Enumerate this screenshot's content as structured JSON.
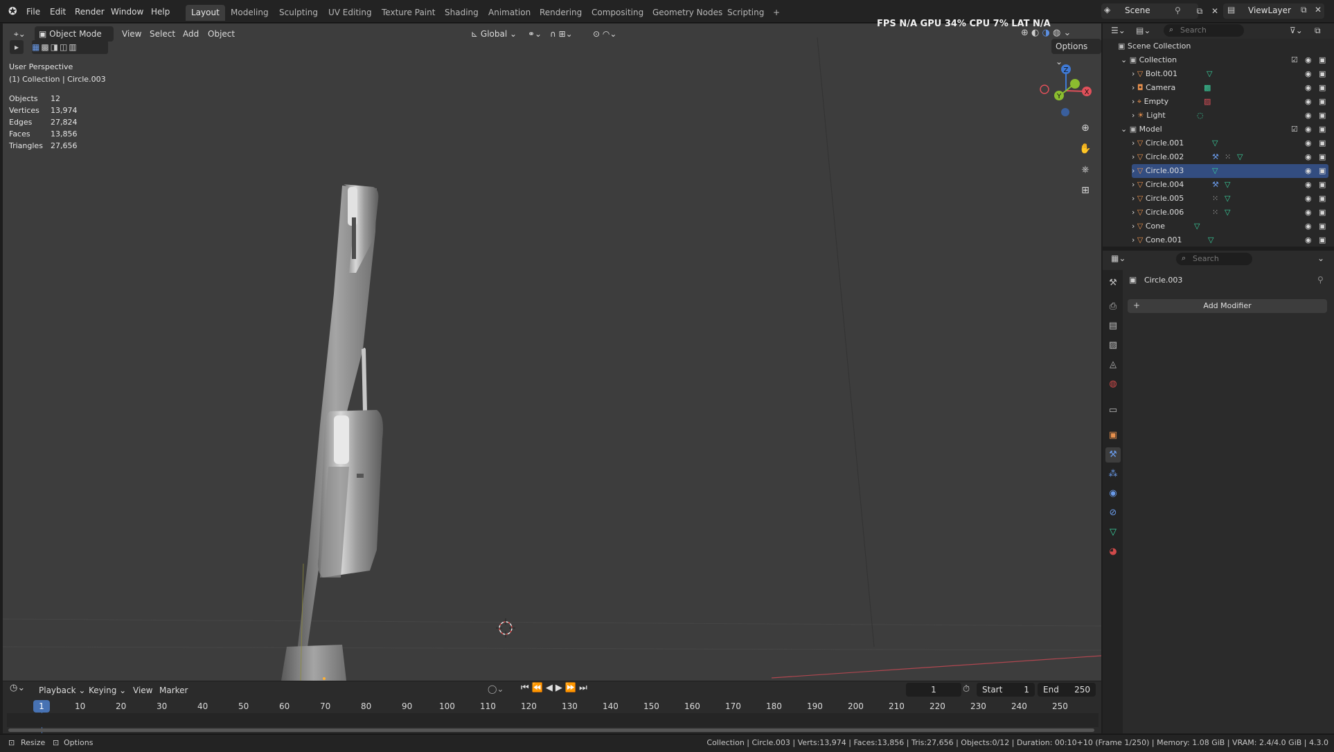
{
  "menubar": {
    "items": [
      "File",
      "Edit",
      "Render",
      "Window",
      "Help"
    ],
    "workspaces": [
      "Layout",
      "Modeling",
      "Sculpting",
      "UV Editing",
      "Texture Paint",
      "Shading",
      "Animation",
      "Rendering",
      "Compositing",
      "Geometry Nodes",
      "Scripting"
    ],
    "active_workspace": "Layout",
    "add_tab": "+",
    "scene_label": "Scene",
    "view_layer_label": "ViewLayer"
  },
  "viewport": {
    "mode": "Object Mode",
    "menus": [
      "View",
      "Select",
      "Add",
      "Object"
    ],
    "orientation": "Global",
    "options_label": "Options",
    "perf_fps_label": "FPS",
    "perf_fps": "N/A",
    "perf_gpu_label": "GPU",
    "perf_gpu": "34%",
    "perf_cpu_label": "CPU",
    "perf_cpu": "7%",
    "perf_lat_label": "LAT",
    "perf_lat": "N/A",
    "view_name": "User Perspective",
    "view_context": "(1) Collection | Circle.003",
    "stats": [
      {
        "label": "Objects",
        "value": "12"
      },
      {
        "label": "Vertices",
        "value": "13,974"
      },
      {
        "label": "Edges",
        "value": "27,824"
      },
      {
        "label": "Faces",
        "value": "13,856"
      },
      {
        "label": "Triangles",
        "value": "27,656"
      }
    ],
    "gizmo_axes": {
      "x": "X",
      "y": "Y",
      "z": "Z"
    }
  },
  "outliner": {
    "search_placeholder": "Search",
    "root": "Scene Collection",
    "collection1": "Collection",
    "collection1_items": [
      "Bolt.001",
      "Camera",
      "Empty",
      "Light"
    ],
    "collection2": "Model",
    "collection2_items": [
      "Circle.001",
      "Circle.002",
      "Circle.003",
      "Circle.004",
      "Circle.005",
      "Circle.006",
      "Cone",
      "Cone.001"
    ]
  },
  "properties": {
    "search_placeholder": "Search",
    "object_name": "Circle.003",
    "add_modifier_label": "Add Modifier"
  },
  "timeline": {
    "menus": [
      "Playback",
      "Keying",
      "View",
      "Marker"
    ],
    "current_frame": "1",
    "start_label": "Start",
    "start_value": "1",
    "end_label": "End",
    "end_value": "250",
    "ticks": [
      "10",
      "20",
      "30",
      "40",
      "50",
      "60",
      "70",
      "80",
      "90",
      "100",
      "110",
      "120",
      "130",
      "140",
      "150",
      "160",
      "170",
      "180",
      "190",
      "200",
      "210",
      "220",
      "230",
      "240",
      "250"
    ],
    "playhead": "1"
  },
  "statusbar": {
    "resize_label": "Resize",
    "options_label": "Options",
    "info": "Collection | Circle.003 | Verts:13,974 | Faces:13,856 | Tris:27,656 | Objects:0/12 | Duration: 00:10+10 (Frame 1/250) | Memory: 1.08 GiB | VRAM: 2.4/4.0 GiB | 4.3.0"
  },
  "colors": {
    "accent": "#4772b3",
    "viewport_bg": "#3d3d3d",
    "x_axis": "#e0505a",
    "y_axis": "#8bbd2f",
    "z_axis": "#3f7ad6",
    "mesh_icon": "#3ad29f",
    "object_icon": "#e8904d"
  }
}
